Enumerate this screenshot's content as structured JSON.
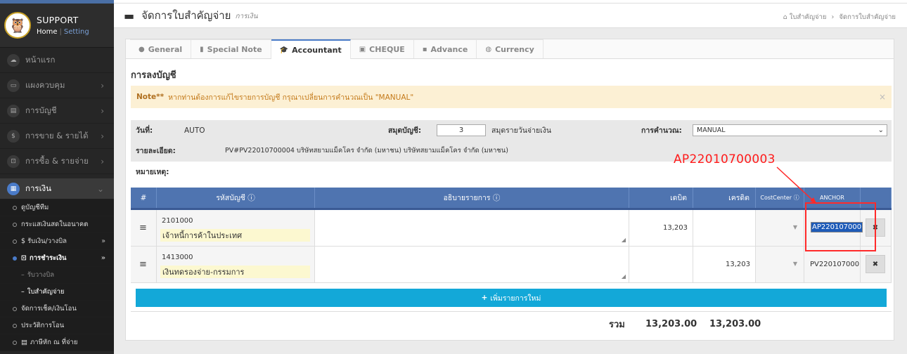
{
  "sidebar": {
    "brand_title": "SUPPORT",
    "home_link": "Home",
    "setting_link": "Setting",
    "items": [
      {
        "label": "หน้าแรก",
        "icon": "cloud-icon"
      },
      {
        "label": "แผงควบคุม",
        "icon": "monitor-icon"
      },
      {
        "label": "การบัญชี",
        "icon": "book-icon"
      },
      {
        "label": "การขาย & รายได้",
        "icon": "dollar-icon"
      },
      {
        "label": "การซื้อ & รายจ่าย",
        "icon": "cart-icon"
      },
      {
        "label": "การเงิน",
        "icon": "calendar-icon"
      }
    ],
    "subs": [
      {
        "label": "ดูบัญชีทีม"
      },
      {
        "label": "กระแสเงินสดในอนาคต"
      },
      {
        "label": "$ รับเงิน/วางบิล"
      },
      {
        "label": "การชำระเงิน"
      },
      {
        "label": "รับวางบิล"
      },
      {
        "label": "ใบสำคัญจ่าย"
      },
      {
        "label": "จัดการเช็ค/เงินโอน"
      },
      {
        "label": "ประวัติการโอน"
      },
      {
        "label": "ภาษีหัก ณ ที่จ่าย"
      }
    ]
  },
  "header": {
    "title": "จัดการใบสำคัญจ่าย",
    "subtitle": "การเงิน",
    "breadcrumb_1": "ใบสำคัญจ่าย",
    "breadcrumb_2": "จัดการใบสำคัญจ่าย"
  },
  "tabs": [
    "General",
    "Special Note",
    "Accountant",
    "CHEQUE",
    "Advance",
    "Currency"
  ],
  "section_title": "การลงบัญชี",
  "note": {
    "prefix": "Note**",
    "text": "หากท่านต้องการแก้ไขรายการบัญชี กรุณาเปลี่ยนการคำนวณเป็น \"MANUAL\"",
    "close": "×"
  },
  "info": {
    "date_label": "วันที่:",
    "date_value": "AUTO",
    "journal_label": "สมุดบัญชี:",
    "journal_value": "3",
    "journal_name": "สมุดรายวันจ่ายเงิน",
    "calc_label": "การคำนวณ:",
    "calc_value": "MANUAL",
    "detail_label": "รายละเอียด:",
    "detail_value": "PV#PV22010700004 บริษัทสยามแม็คโคร จำกัด (มหาชน) บริษัทสยามแม็คโคร จำกัด (มหาชน)",
    "remark_label": "หมายเหตุ:"
  },
  "table": {
    "headers": {
      "num": "#",
      "account": "รหัสบัญชี",
      "description": "อธิบายรายการ",
      "debit": "เดบิต",
      "credit": "เครดิต",
      "cost_center": "CostCenter",
      "anchor": "ANCHOR"
    },
    "rows": [
      {
        "code": "2101000",
        "name": "เจ้าหนี้การค้าในประเทศ",
        "debit": "13,203",
        "credit": "",
        "anchor": "AP220107000"
      },
      {
        "code": "1413000",
        "name": "เงินทดรองจ่าย-กรรมการ",
        "debit": "",
        "credit": "13,203",
        "anchor": "PV220107000"
      }
    ],
    "add_label": "เพิ่มรายการใหม่",
    "total_label": "รวม",
    "total_debit": "13,203.00",
    "total_credit": "13,203.00"
  },
  "annotation": {
    "label": "AP22010700003",
    "color": "#ff1a1a"
  }
}
